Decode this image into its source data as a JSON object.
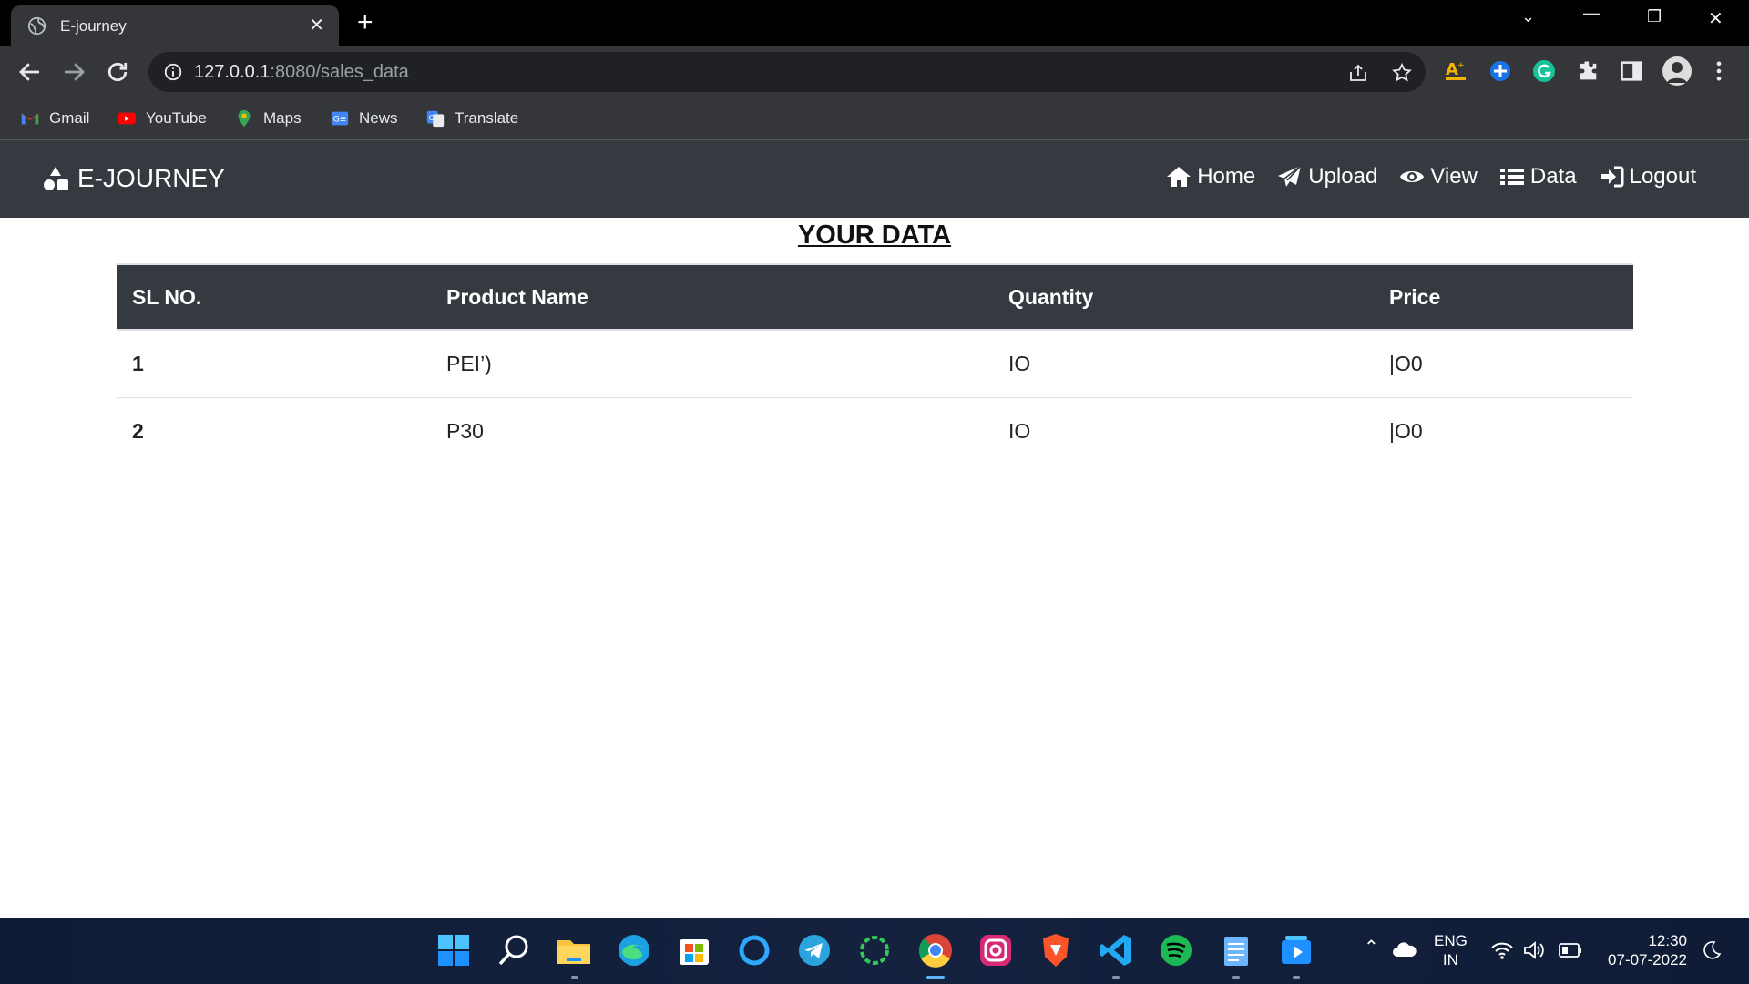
{
  "browser": {
    "tab_title": "E-journey",
    "url_host": "127.0.0.1",
    "url_path": ":8080/sales_data",
    "bookmarks": [
      "Gmail",
      "YouTube",
      "Maps",
      "News",
      "Translate"
    ]
  },
  "navbar": {
    "brand": "E-JOURNEY",
    "links": [
      "Home",
      "Upload",
      "View",
      "Data",
      "Logout"
    ]
  },
  "page": {
    "title": "YOUR DATA"
  },
  "table": {
    "headers": [
      "SL NO.",
      "Product Name",
      "Quantity",
      "Price"
    ],
    "rows": [
      [
        "1",
        "PEI’)",
        "IO",
        "|O0"
      ],
      [
        "2",
        "P30",
        "IO",
        "|O0"
      ]
    ]
  },
  "taskbar": {
    "lang": "ENG",
    "region": "IN",
    "time": "12:30",
    "date": "07-07-2022"
  },
  "colors": {
    "navbar": "#343a40",
    "table_header": "#343a40",
    "browser_frame": "#35363a"
  }
}
